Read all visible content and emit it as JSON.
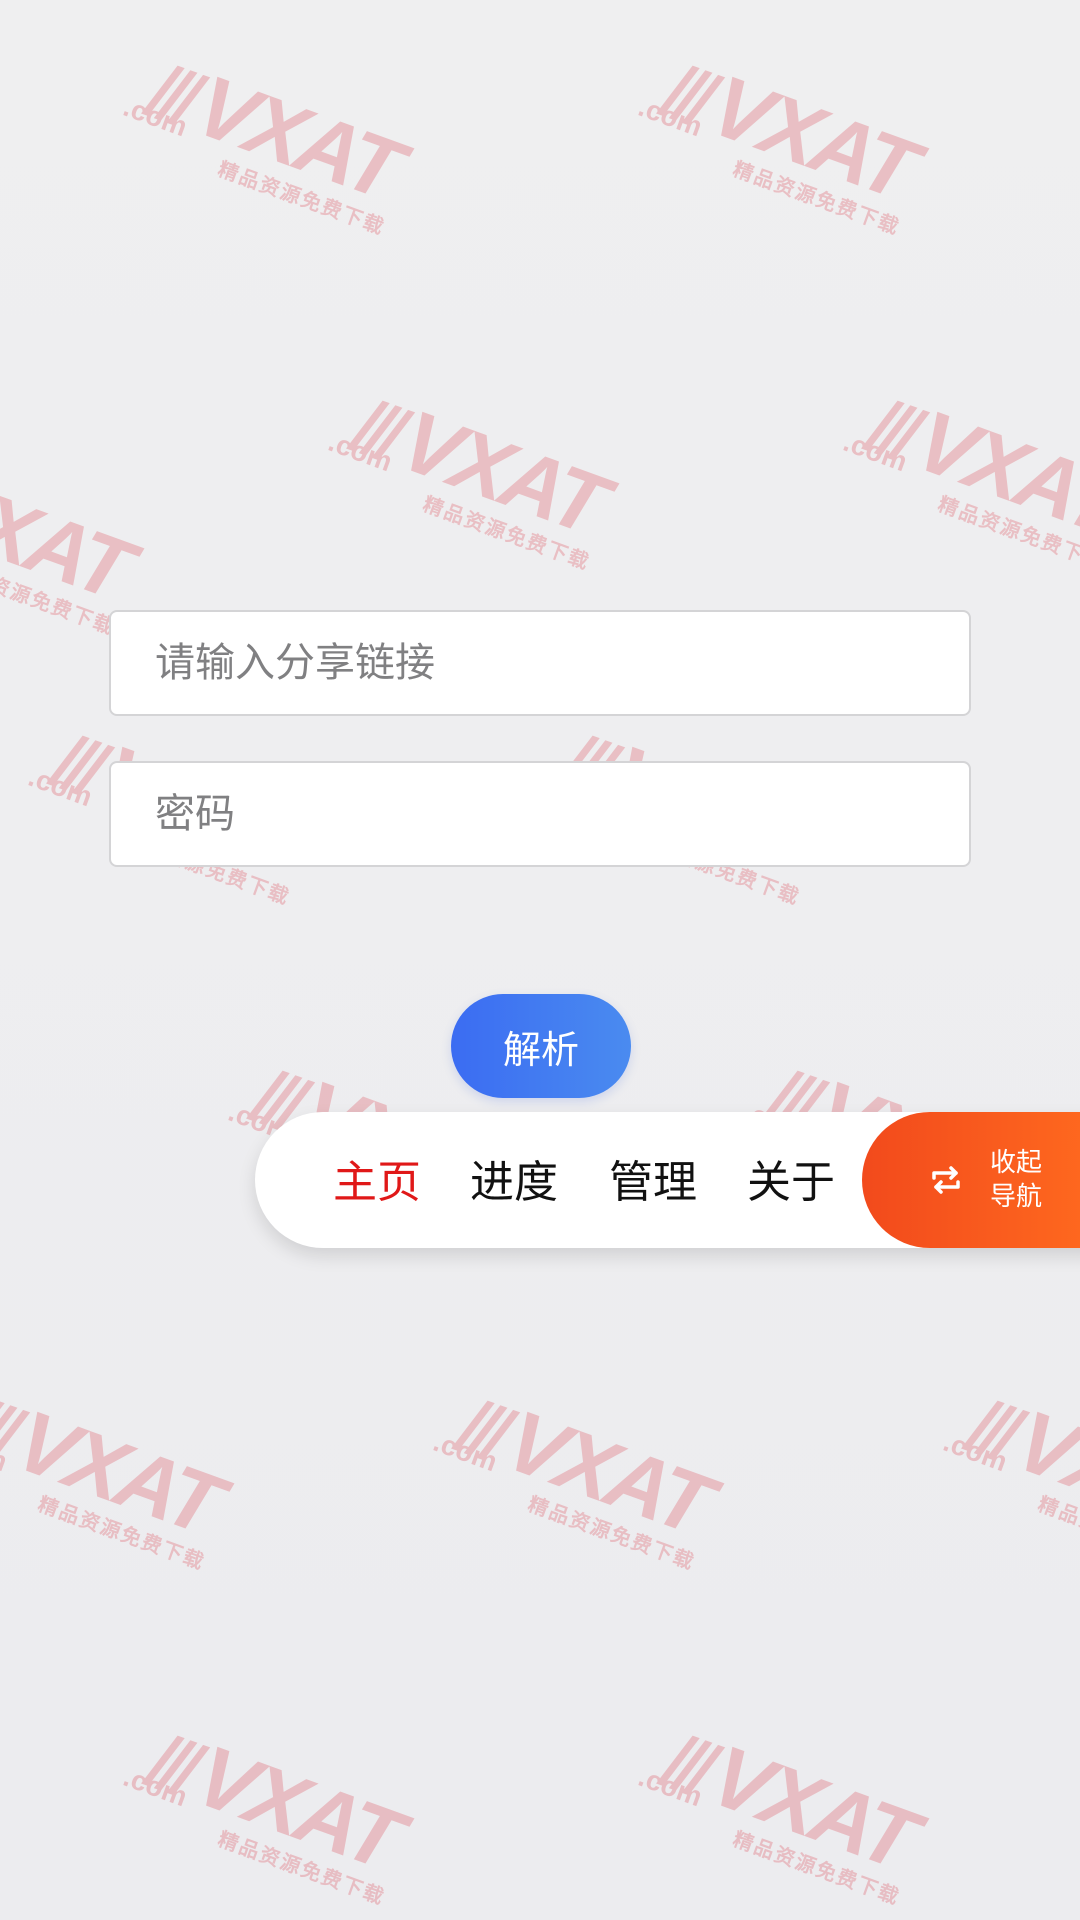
{
  "form": {
    "link_placeholder": "请输入分享链接",
    "password_placeholder": "密码",
    "parse_label": "解析"
  },
  "nav": {
    "items": [
      {
        "label": "主页",
        "active": true
      },
      {
        "label": "进度",
        "active": false
      },
      {
        "label": "管理",
        "active": false
      },
      {
        "label": "关于",
        "active": false
      }
    ],
    "collapse_label": "收起\n导航",
    "collapse_icon": "repeat-icon",
    "active_color": "#e01818",
    "collapse_color": "#f24a1c"
  },
  "watermark": {
    "brand": "VXAT",
    "domain": ".com",
    "slashes": "///",
    "subtitle": "精品资源免费下载"
  },
  "theme": {
    "primary": "#3b6cf2",
    "background": "#eeeef0"
  }
}
